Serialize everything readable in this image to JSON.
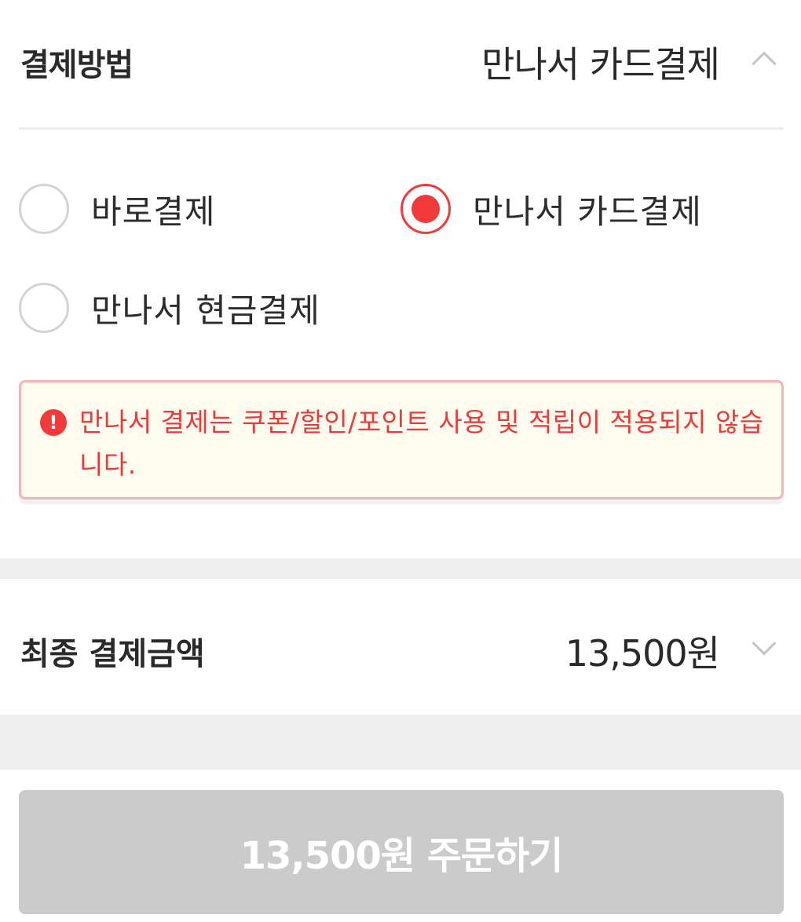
{
  "payment_method": {
    "title": "결제방법",
    "selected_value": "만나서 카드결제",
    "options": [
      {
        "label": "바로결제",
        "checked": false
      },
      {
        "label": "만나서 카드결제",
        "checked": true
      },
      {
        "label": "만나서 현금결제",
        "checked": false
      }
    ],
    "notice_icon": "!",
    "notice_text": "만나서 결제는 쿠폰/할인/포인트 사용 및 적립이 적용되지 않습니다."
  },
  "total": {
    "label": "최종 결제금액",
    "amount": "13,500원"
  },
  "order_button": {
    "label": "13,500원 주문하기"
  },
  "colors": {
    "accent": "#f23a3a",
    "notice_bg": "#fffbee",
    "notice_border": "#f5b3b3",
    "button_disabled": "#cbcbcb"
  }
}
